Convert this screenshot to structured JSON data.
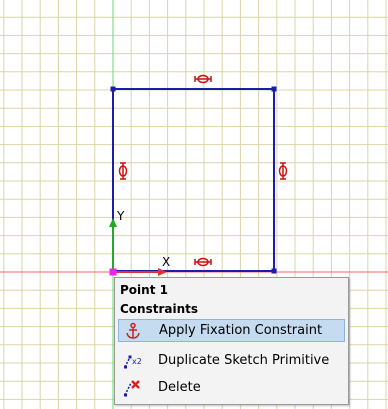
{
  "colors": {
    "grid": "#d9d5a7",
    "x_axis": "#ff6060",
    "y_axis": "#66dd66",
    "sketch_line": "#1c1caa",
    "constraint_marker": "#cc1111",
    "origin_point": "#ee22ee",
    "menu_highlight": "#c5dbf0"
  },
  "axes": {
    "x_label": "X",
    "y_label": "Y"
  },
  "context_menu": {
    "header_title": "Point 1",
    "header_subtitle": "Constraints",
    "items": [
      {
        "label": "Apply Fixation Constraint",
        "icon": "anchor-icon",
        "highlighted": true
      },
      {
        "label": "Duplicate Sketch Primitive",
        "icon": "duplicate-icon",
        "highlighted": false
      },
      {
        "label": "Delete",
        "icon": "delete-icon",
        "highlighted": false
      }
    ]
  }
}
